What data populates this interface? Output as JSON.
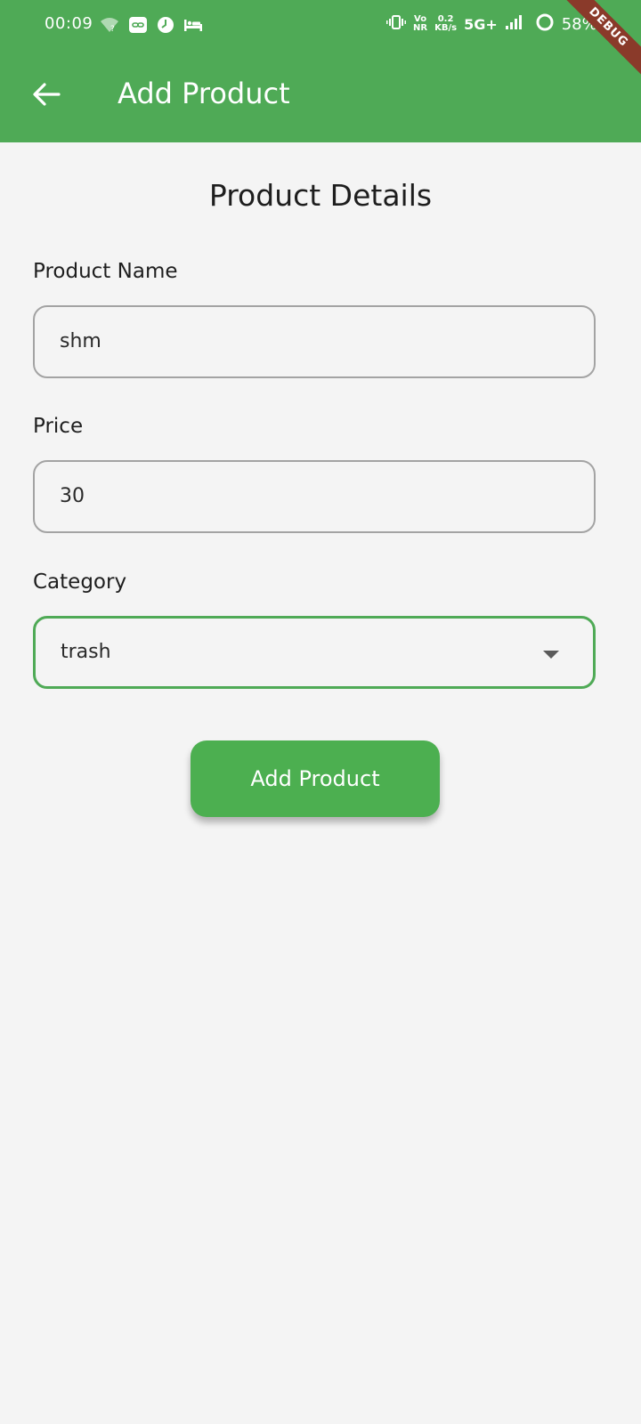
{
  "status_bar": {
    "time": "00:09",
    "vo_nr_top": "Vo",
    "vo_nr_bottom": "NR",
    "speed_value": "0.2",
    "speed_unit": "KB/s",
    "network": "5G+",
    "battery": "58%"
  },
  "debug_banner": "DEBUG",
  "app_bar": {
    "title": "Add Product"
  },
  "form": {
    "section_title": "Product Details",
    "product_name": {
      "label": "Product Name",
      "value": "shm"
    },
    "price": {
      "label": "Price",
      "value": "30"
    },
    "category": {
      "label": "Category",
      "selected": "trash"
    },
    "submit_label": "Add Product"
  },
  "colors": {
    "primary": "#4faa56",
    "button": "#4caf50",
    "background": "#f4f4f4",
    "debug_ribbon": "#8a3a2a"
  },
  "icons": [
    "wifi-icon",
    "link-icon",
    "clock-icon",
    "bed-icon",
    "vibrate-icon",
    "signal-icon",
    "battery-ring-icon",
    "back-arrow-icon",
    "chevron-down-icon"
  ]
}
